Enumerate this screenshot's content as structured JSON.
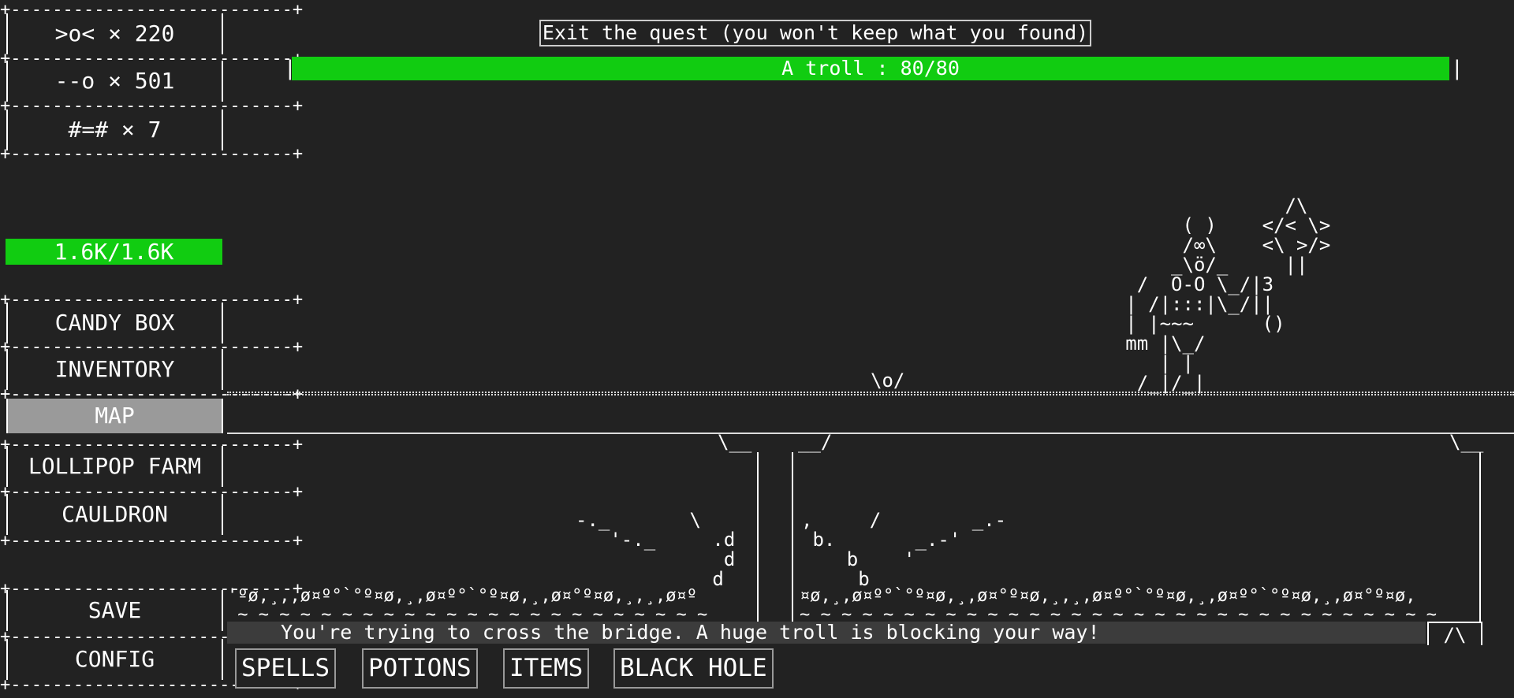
{
  "sidebar": {
    "resources": [
      {
        "icon": ">o<",
        "count": "× 220"
      },
      {
        "icon": "--o",
        "count": "× 501"
      },
      {
        "icon": "#=#",
        "count": "× 7"
      }
    ],
    "health": "1.6K/1.6K",
    "nav": [
      {
        "label": "CANDY BOX"
      },
      {
        "label": "INVENTORY"
      },
      {
        "label": "MAP"
      },
      {
        "label": "LOLLIPOP FARM"
      },
      {
        "label": "CAULDRON"
      }
    ],
    "active_nav": "MAP",
    "bottom": [
      {
        "label": "SAVE"
      },
      {
        "label": "CONFIG"
      }
    ]
  },
  "quest": {
    "exit_label": "Exit the quest (you won't keep what you found)",
    "enemy_bar": "A troll : 80/80",
    "enemy_hp_fraction": 1.0,
    "message": "You're trying to cross the bridge. A huge troll is blocking your way!",
    "scroll_label": "/\\"
  },
  "tabs": [
    {
      "label": "SPELLS"
    },
    {
      "label": "POTIONS"
    },
    {
      "label": "ITEMS"
    },
    {
      "label": "BLACK HOLE"
    }
  ],
  "colors": {
    "background": "#222222",
    "health_green": "#11cc11",
    "active_gray": "#9a9a9a"
  }
}
